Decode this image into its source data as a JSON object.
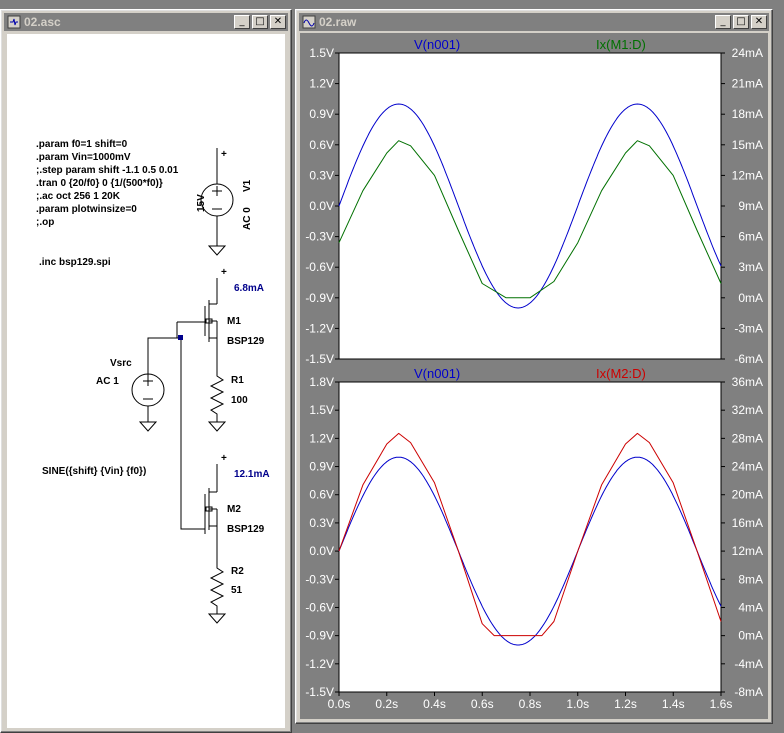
{
  "schematic_window": {
    "title": "02.asc",
    "directives": [
      ".param f0=1 shift=0",
      ".param  Vin=1000mV",
      ";.step param shift -1.1 0.5 0.01",
      ".tran 0 {20/f0} 0 {1/(500*f0)}",
      ";.ac oct 256 1 20K",
      ".param plotwinsize=0",
      ";.op"
    ],
    "include": ".inc bsp129.spi",
    "sine_expr": "SINE({shift} {Vin} {f0})",
    "components": {
      "v1_name": "V1",
      "v1_value": "15V",
      "v1_ac": "AC 0",
      "vsrc_name": "Vsrc",
      "vsrc_ac": "AC 1",
      "m1_name": "M1",
      "m1_model": "BSP129",
      "m1_current": "6.8mA",
      "r1_name": "R1",
      "r1_value": "100",
      "m2_name": "M2",
      "m2_model": "BSP129",
      "m2_current": "12.1mA",
      "r2_name": "R2",
      "r2_value": "51",
      "plus": "+"
    }
  },
  "waveform_window": {
    "title": "02.raw",
    "top_pane": {
      "left_trace": "V(n001)",
      "right_trace": "Ix(M1:D)",
      "left_color": "#0000cc",
      "right_color": "#007000",
      "y_left_ticks": [
        "1.5V",
        "1.2V",
        "0.9V",
        "0.6V",
        "0.3V",
        "0.0V",
        "-0.3V",
        "-0.6V",
        "-0.9V",
        "-1.2V",
        "-1.5V"
      ],
      "y_right_ticks": [
        "24mA",
        "21mA",
        "18mA",
        "15mA",
        "12mA",
        "9mA",
        "6mA",
        "3mA",
        "0mA",
        "-3mA",
        "-6mA"
      ]
    },
    "bottom_pane": {
      "left_trace": "V(n001)",
      "right_trace": "Ix(M2:D)",
      "left_color": "#0000cc",
      "right_color": "#cc0000",
      "y_left_ticks": [
        "1.8V",
        "1.5V",
        "1.2V",
        "0.9V",
        "0.6V",
        "0.3V",
        "0.0V",
        "-0.3V",
        "-0.6V",
        "-0.9V",
        "-1.2V",
        "-1.5V"
      ],
      "y_right_ticks": [
        "36mA",
        "32mA",
        "28mA",
        "24mA",
        "20mA",
        "16mA",
        "12mA",
        "8mA",
        "4mA",
        "0mA",
        "-4mA",
        "-8mA"
      ],
      "x_ticks": [
        "0.0s",
        "0.2s",
        "0.4s",
        "0.6s",
        "0.8s",
        "1.0s",
        "1.2s",
        "1.4s",
        "1.6s"
      ]
    }
  },
  "chart_data": [
    {
      "type": "line",
      "x_range": [
        0,
        1.6
      ],
      "ylim": [
        -1.5,
        1.5
      ],
      "y2lim": [
        -6,
        24
      ],
      "series": [
        {
          "name": "V(n001)",
          "axis": "left",
          "units": "V",
          "amplitude": 1.0,
          "frequency_hz": 1.0,
          "offset": 0
        },
        {
          "name": "Ix(M1:D)",
          "axis": "right",
          "units": "mA",
          "peak": 15.4,
          "min_clip": 0,
          "x_points": [
            0,
            0.1,
            0.2,
            0.25,
            0.3,
            0.4,
            0.5,
            0.6,
            0.7,
            0.8,
            0.9,
            1.0,
            1.1,
            1.2,
            1.25,
            1.3,
            1.4,
            1.5,
            1.6
          ],
          "y_points": [
            5.4,
            10.5,
            14.2,
            15.4,
            14.9,
            12.0,
            6.6,
            1.4,
            0,
            0,
            1.6,
            5.4,
            10.5,
            14.2,
            15.4,
            14.9,
            12.0,
            6.6,
            1.4
          ]
        }
      ],
      "grid": false
    },
    {
      "type": "line",
      "x_range": [
        0,
        1.6
      ],
      "ylim": [
        -1.5,
        1.8
      ],
      "y2lim": [
        -8,
        36
      ],
      "series": [
        {
          "name": "V(n001)",
          "axis": "left",
          "units": "V",
          "amplitude": 1.0,
          "frequency_hz": 1.0,
          "offset": 0
        },
        {
          "name": "Ix(M2:D)",
          "axis": "right",
          "units": "mA",
          "x_points": [
            0,
            0.1,
            0.2,
            0.25,
            0.3,
            0.4,
            0.5,
            0.6,
            0.65,
            0.75,
            0.85,
            0.9,
            1.0,
            1.1,
            1.2,
            1.25,
            1.3,
            1.4,
            1.5,
            1.6
          ],
          "y_points": [
            12.0,
            21.4,
            27.2,
            28.7,
            27.4,
            21.7,
            12.0,
            1.7,
            0,
            0,
            0,
            2.0,
            12.0,
            21.4,
            27.2,
            28.7,
            27.4,
            21.7,
            12.0,
            2.0
          ]
        }
      ],
      "grid": false
    }
  ]
}
